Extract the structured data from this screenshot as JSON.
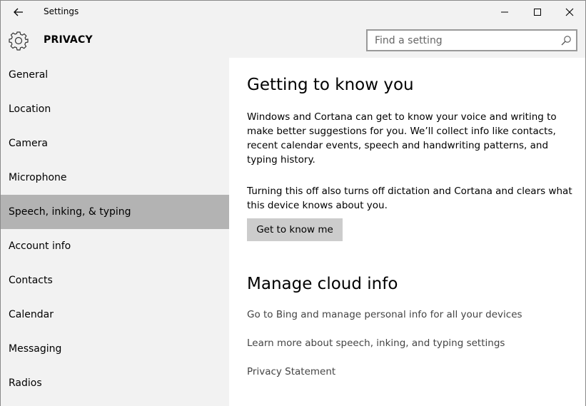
{
  "window": {
    "title": "Settings"
  },
  "header": {
    "section": "PRIVACY",
    "search_placeholder": "Find a setting"
  },
  "sidebar": {
    "items": [
      {
        "label": "General",
        "selected": false
      },
      {
        "label": "Location",
        "selected": false
      },
      {
        "label": "Camera",
        "selected": false
      },
      {
        "label": "Microphone",
        "selected": false
      },
      {
        "label": "Speech, inking, & typing",
        "selected": true
      },
      {
        "label": "Account info",
        "selected": false
      },
      {
        "label": "Contacts",
        "selected": false
      },
      {
        "label": "Calendar",
        "selected": false
      },
      {
        "label": "Messaging",
        "selected": false
      },
      {
        "label": "Radios",
        "selected": false
      }
    ]
  },
  "main": {
    "section1": {
      "heading": "Getting to know you",
      "para1": "Windows and Cortana can get to know your voice and writing to make better suggestions for you. We’ll collect info like contacts, recent calendar events, speech and handwriting patterns, and typing history.",
      "para2": "Turning this off also turns off dictation and Cortana and clears what this device knows about you.",
      "button": "Get to know me"
    },
    "section2": {
      "heading": "Manage cloud info",
      "links": [
        "Go to Bing and manage personal info for all your devices",
        "Learn more about speech, inking, and typing settings",
        "Privacy Statement"
      ]
    }
  },
  "colors": {
    "selected_bg": "#b3b3b3",
    "sidebar_bg": "#f2f2f2",
    "content_bg": "#ffffff",
    "button_bg": "#cccccc"
  }
}
